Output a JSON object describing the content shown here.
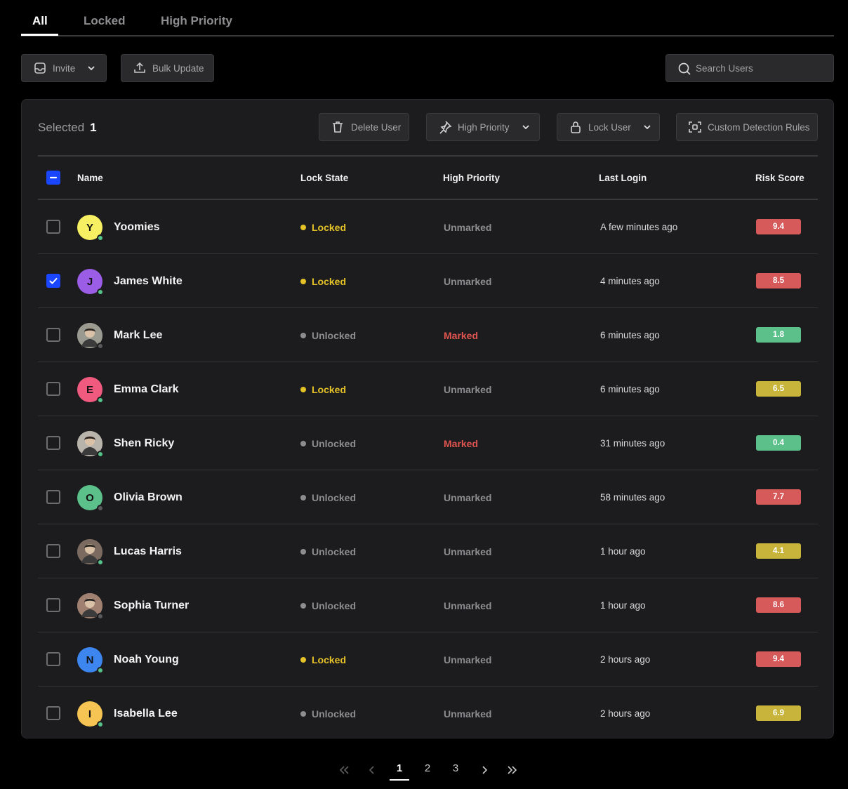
{
  "tabs": [
    {
      "label": "All",
      "active": true
    },
    {
      "label": "Locked",
      "active": false
    },
    {
      "label": "High Priority",
      "active": false
    }
  ],
  "toolbar": {
    "invite_label": "Invite",
    "bulk_update_label": "Bulk Update",
    "search_placeholder": "Search Users"
  },
  "selection": {
    "label": "Selected",
    "count": "1"
  },
  "actions": {
    "delete_label": "Delete User",
    "high_priority_label": "High Priority",
    "lock_label": "Lock User",
    "rules_label": "Custom Detection Rules"
  },
  "columns": {
    "name": "Name",
    "lock_state": "Lock State",
    "high_priority": "High Priority",
    "last_login": "Last Login",
    "risk_score": "Risk Score"
  },
  "colors": {
    "locked": "#e4c228",
    "unlocked": "#8d8d90",
    "marked": "#e0544f",
    "risk_high": "#d65a5a",
    "risk_mid": "#c8b43a",
    "risk_low": "#5cc08a",
    "online": "#56c48a",
    "offline": "#5a5a5c",
    "accent": "#1a46ff"
  },
  "rows": [
    {
      "name": "Yoomies",
      "initial": "Y",
      "avatar_color": "#f7f062",
      "photo": false,
      "online": true,
      "checked": false,
      "lock_state": "Locked",
      "priority": "Unmarked",
      "last_login": "A few minutes ago",
      "risk": "9.4",
      "risk_level": "high"
    },
    {
      "name": "James White",
      "initial": "J",
      "avatar_color": "#9b5de5",
      "photo": false,
      "online": true,
      "checked": true,
      "lock_state": "Locked",
      "priority": "Unmarked",
      "last_login": "4 minutes ago",
      "risk": "8.5",
      "risk_level": "high"
    },
    {
      "name": "Mark Lee",
      "initial": "",
      "avatar_color": "#9a9a90",
      "photo": true,
      "online": false,
      "checked": false,
      "lock_state": "Unlocked",
      "priority": "Marked",
      "last_login": "6 minutes ago",
      "risk": "1.8",
      "risk_level": "low"
    },
    {
      "name": "Emma Clark",
      "initial": "E",
      "avatar_color": "#f05a7e",
      "photo": false,
      "online": true,
      "checked": false,
      "lock_state": "Locked",
      "priority": "Unmarked",
      "last_login": "6 minutes ago",
      "risk": "6.5",
      "risk_level": "mid"
    },
    {
      "name": "Shen Ricky",
      "initial": "",
      "avatar_color": "#b8b4ac",
      "photo": true,
      "online": true,
      "checked": false,
      "lock_state": "Unlocked",
      "priority": "Marked",
      "last_login": "31 minutes ago",
      "risk": "0.4",
      "risk_level": "low"
    },
    {
      "name": "Olivia Brown",
      "initial": "O",
      "avatar_color": "#5cc08a",
      "photo": false,
      "online": false,
      "checked": false,
      "lock_state": "Unlocked",
      "priority": "Unmarked",
      "last_login": "58 minutes ago",
      "risk": "7.7",
      "risk_level": "high"
    },
    {
      "name": "Lucas Harris",
      "initial": "",
      "avatar_color": "#7a6a60",
      "photo": true,
      "online": true,
      "checked": false,
      "lock_state": "Unlocked",
      "priority": "Unmarked",
      "last_login": "1 hour ago",
      "risk": "4.1",
      "risk_level": "mid"
    },
    {
      "name": "Sophia Turner",
      "initial": "",
      "avatar_color": "#a08070",
      "photo": true,
      "online": false,
      "checked": false,
      "lock_state": "Unlocked",
      "priority": "Unmarked",
      "last_login": "1 hour ago",
      "risk": "8.6",
      "risk_level": "high"
    },
    {
      "name": "Noah Young",
      "initial": "N",
      "avatar_color": "#3d86f0",
      "photo": false,
      "online": true,
      "checked": false,
      "lock_state": "Locked",
      "priority": "Unmarked",
      "last_login": "2 hours ago",
      "risk": "9.4",
      "risk_level": "high"
    },
    {
      "name": "Isabella Lee",
      "initial": "I",
      "avatar_color": "#f5c453",
      "photo": false,
      "online": true,
      "checked": false,
      "lock_state": "Unlocked",
      "priority": "Unmarked",
      "last_login": "2 hours ago",
      "risk": "6.9",
      "risk_level": "mid"
    }
  ],
  "pagination": {
    "pages": [
      "1",
      "2",
      "3"
    ],
    "current": "1"
  }
}
